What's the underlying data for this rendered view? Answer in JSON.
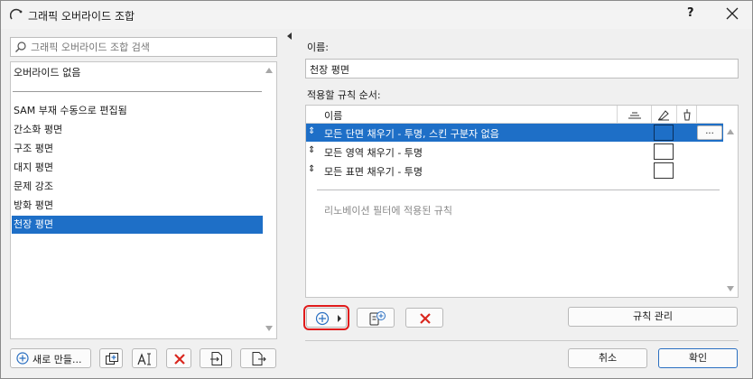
{
  "window": {
    "title": "그래픽 오버라이드 조합",
    "help_label": "?"
  },
  "left": {
    "search": {
      "placeholder": "그래픽 오버라이드 조합 검색",
      "value": ""
    },
    "none_item": "오버라이드 없음",
    "items": [
      {
        "label": "SAM 부재 수동으로 편집됨",
        "selected": false
      },
      {
        "label": "간소화 평면",
        "selected": false
      },
      {
        "label": "구조 평면",
        "selected": false
      },
      {
        "label": "대지 평면",
        "selected": false
      },
      {
        "label": "문제 강조",
        "selected": false
      },
      {
        "label": "방화 평면",
        "selected": false
      },
      {
        "label": "천장 평면",
        "selected": true
      }
    ],
    "buttons": {
      "new_label": "새로 만들..."
    }
  },
  "right": {
    "name_label": "이름:",
    "name_value": "천장 평면",
    "rules_label": "적용할 규칙 순서:",
    "column_name": "이름",
    "rules": [
      {
        "label": "모든 단면 채우기 - 투명, 스킨 구분자 없음",
        "selected": true
      },
      {
        "label": "모든 영역 채우기 - 투명",
        "selected": false
      },
      {
        "label": "모든 표면 채우기 - 투명",
        "selected": false
      }
    ],
    "more_label": "...",
    "renovation_text": "리노베이션 필터에 적용된 규칙",
    "manage_rules_label": "규칙 관리"
  },
  "footer": {
    "cancel_label": "취소",
    "ok_label": "확인"
  },
  "colors": {
    "selection": "#1e6fc7",
    "highlight_outline": "#e01b1b",
    "delete_red": "#d9271e"
  }
}
